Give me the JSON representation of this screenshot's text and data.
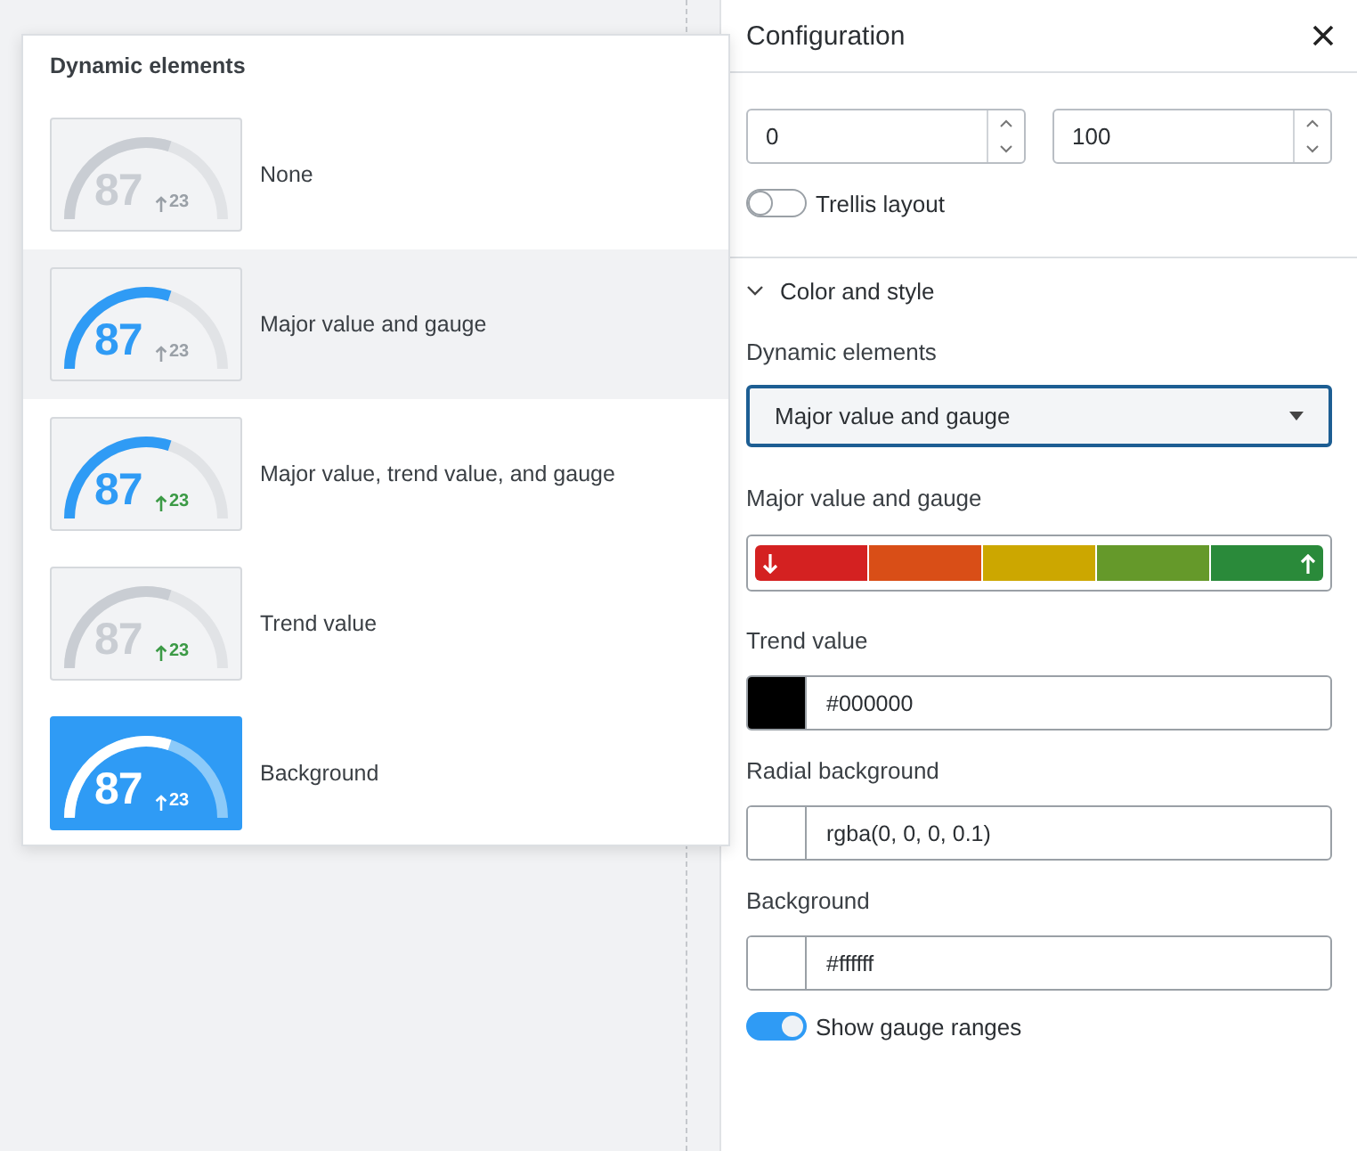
{
  "popup": {
    "title": "Dynamic elements",
    "options": [
      {
        "kind": "none",
        "label": "None",
        "value": "87",
        "trend": "23",
        "selected": false
      },
      {
        "kind": "gauge",
        "label": "Major value and gauge",
        "value": "87",
        "trend": "23",
        "selected": true
      },
      {
        "kind": "trend_gauge",
        "label": "Major value, trend value, and gauge",
        "value": "87",
        "trend": "23",
        "selected": false
      },
      {
        "kind": "trend",
        "label": "Trend value",
        "value": "87",
        "trend": "23",
        "selected": false
      },
      {
        "kind": "background",
        "label": "Background",
        "value": "87",
        "trend": "23",
        "selected": false
      }
    ]
  },
  "panel": {
    "title": "Configuration",
    "number_fields": [
      {
        "value": "0"
      },
      {
        "value": "100"
      }
    ],
    "trellis_toggle": {
      "label": "Trellis layout",
      "on": false
    },
    "section": {
      "title": "Color and style",
      "expanded": true
    },
    "dynamic_elements": {
      "label": "Dynamic elements",
      "value": "Major value and gauge"
    },
    "ranges": {
      "label": "Major value and gauge",
      "segments": [
        {
          "kind": "low",
          "color": "#d42121"
        },
        {
          "kind": "mid",
          "color": "#d94e17"
        },
        {
          "kind": "mid",
          "color": "#cca700"
        },
        {
          "kind": "mid",
          "color": "#65992a"
        },
        {
          "kind": "high",
          "color": "#2a8a3a"
        }
      ]
    },
    "color_fields": [
      {
        "label": "Trend value",
        "value": "#000000",
        "color": "#000000"
      },
      {
        "label": "Radial background",
        "value": "rgba(0, 0, 0, 0.1)",
        "color": "#ffffff"
      },
      {
        "label": "Background",
        "value": "#ffffff",
        "color": "#ffffff"
      }
    ],
    "gauge_ranges_toggle": {
      "label": "Show gauge ranges",
      "on": true
    }
  }
}
